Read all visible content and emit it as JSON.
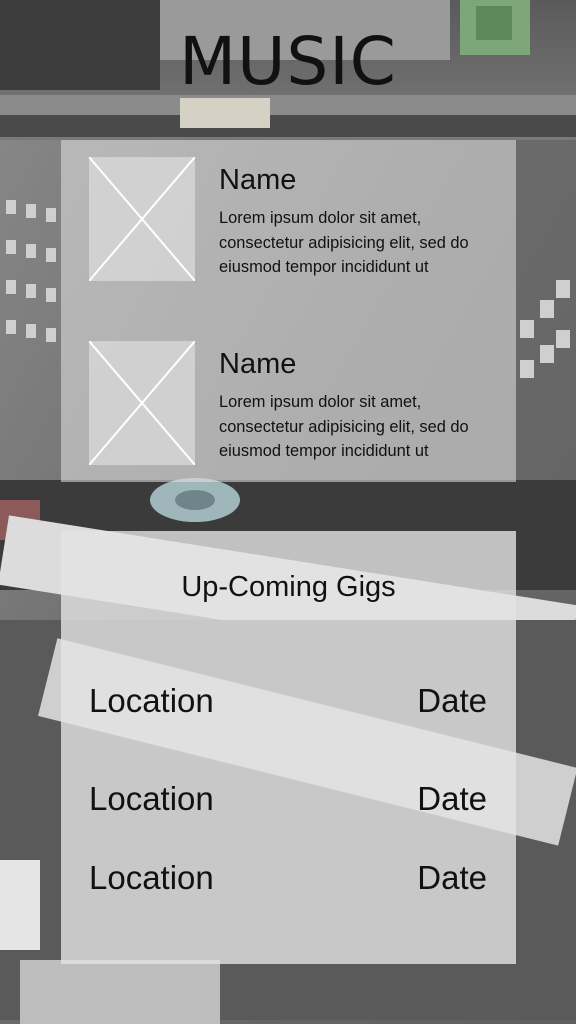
{
  "page": {
    "title": "MUSIC",
    "background_image": "mixing-console-photo"
  },
  "featured": {
    "items": [
      {
        "name": "Name",
        "description": "Lorem ipsum dolor sit amet, consectetur adipisicing elit, sed do eiusmod tempor incididunt ut",
        "image": "image-placeholder"
      },
      {
        "name": "Name",
        "description": "Lorem ipsum dolor sit amet, consectetur adipisicing elit, sed do eiusmod tempor incididunt ut",
        "image": "image-placeholder"
      }
    ]
  },
  "gigs": {
    "title": "Up-Coming Gigs",
    "rows": [
      {
        "location": "Location",
        "date": "Date"
      },
      {
        "location": "Location",
        "date": "Date"
      },
      {
        "location": "Location",
        "date": "Date"
      }
    ]
  },
  "colors": {
    "panel": "#e4e4e4",
    "text": "#111111",
    "background": "#6f6f6f"
  }
}
